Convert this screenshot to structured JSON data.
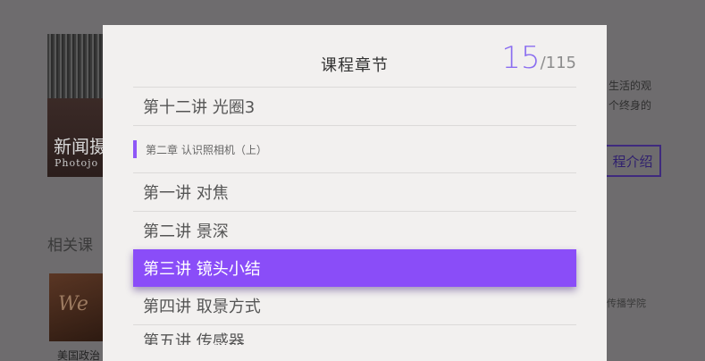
{
  "background": {
    "course_title": "新闻摄",
    "course_subtitle": "Photojo",
    "related_label": "相关课",
    "related_script": "We",
    "related_caption": "美国政治",
    "right_text_1": "生活的观",
    "right_text_2": "个终身的",
    "intro_button": "程介绍",
    "school_text": "传播学院"
  },
  "modal": {
    "title": "课程章节",
    "counter": {
      "current": "15",
      "slash": "/",
      "total": "115"
    },
    "items": [
      {
        "type": "lesson",
        "label": "第十二讲 光圈3"
      },
      {
        "type": "chapter",
        "label": "第二章 认识照相机（上）"
      },
      {
        "type": "lesson",
        "label": "第一讲 对焦"
      },
      {
        "type": "lesson",
        "label": "第二讲 景深"
      },
      {
        "type": "lesson",
        "label": "第三讲 镜头小结",
        "active": true
      },
      {
        "type": "lesson",
        "label": "第四讲 取景方式"
      },
      {
        "type": "lesson",
        "label": "第五讲 传感器"
      }
    ]
  },
  "colors": {
    "accent": "#8a4df8",
    "chapter_bar": "#8e57f7",
    "counter": "#8a6df0"
  }
}
